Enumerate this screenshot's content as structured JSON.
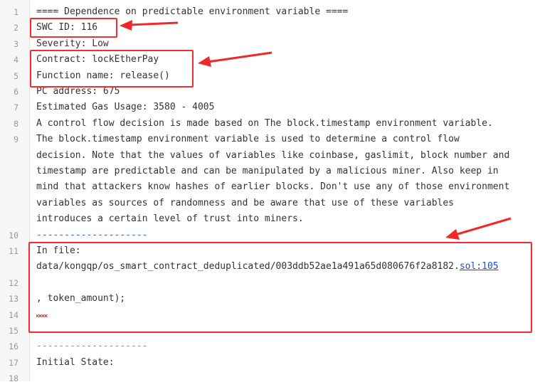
{
  "lines": [
    {
      "num": "1",
      "text": "==== Dependence on predictable environment variable ===="
    },
    {
      "num": "2",
      "text": "SWC ID: 116"
    },
    {
      "num": "3",
      "text": "Severity: Low"
    },
    {
      "num": "4",
      "text": "Contract: lockEtherPay"
    },
    {
      "num": "5",
      "text": "Function name: release()"
    },
    {
      "num": "6",
      "text": "PC address: 675"
    },
    {
      "num": "7",
      "text": "Estimated Gas Usage: 3580 - 4005"
    },
    {
      "num": "8",
      "text": "A control flow decision is made based on The block.timestamp environment variable."
    },
    {
      "num": "9",
      "text": "The block.timestamp environment variable is used to determine a control flow"
    },
    {
      "num": "",
      "text": "decision. Note that the values of variables like coinbase, gaslimit, block number and"
    },
    {
      "num": "",
      "text": "timestamp are predictable and can be manipulated by a malicious miner. Also keep in"
    },
    {
      "num": "",
      "text": "mind that attackers know hashes of earlier blocks. Don't use any of those environment"
    },
    {
      "num": "",
      "text": "variables as sources of randomness and be aware that use of these variables"
    },
    {
      "num": "",
      "text": "introduces a certain level of trust into miners."
    },
    {
      "num": "10",
      "text": "--------------------"
    },
    {
      "num": "11",
      "text": "In file:"
    },
    {
      "num": "",
      "text": "data/kongqp/os_smart_contract_deduplicated/003ddb52ae1a491a65d080676f2a8182.",
      "link": "sol:105"
    },
    {
      "num": "12",
      "text": ""
    },
    {
      "num": "13",
      "text": ", token_amount);"
    },
    {
      "num": "14",
      "text": ""
    },
    {
      "num": "15",
      "text": ""
    },
    {
      "num": "16",
      "text": "--------------------"
    },
    {
      "num": "17",
      "text": "Initial State:"
    },
    {
      "num": "18",
      "text": ""
    }
  ],
  "colors": {
    "highlight": "#f03030",
    "link": "#1a4fd6",
    "separator": "#3060c8"
  }
}
